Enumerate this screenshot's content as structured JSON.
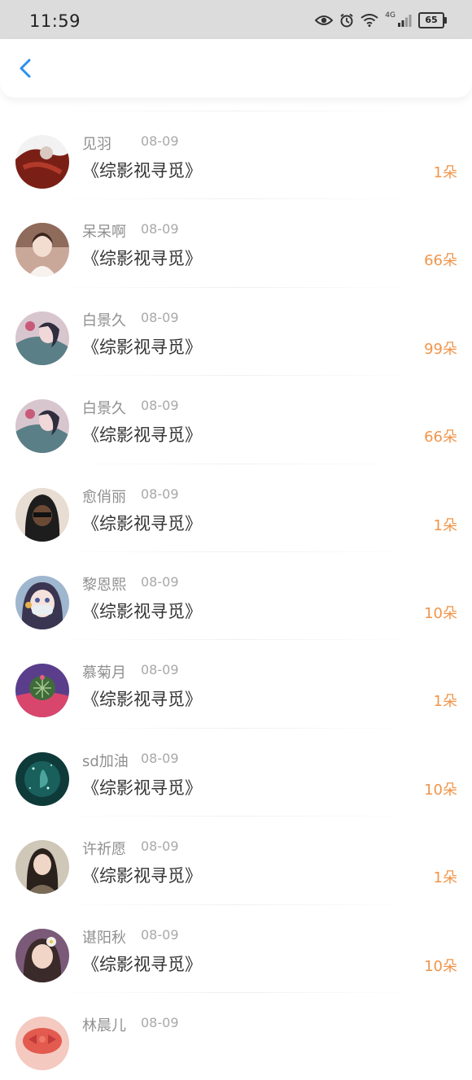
{
  "status_bar": {
    "time": "11:59",
    "battery": "65",
    "network": "4G"
  },
  "nav": {
    "back_icon": "chevron-left-icon",
    "accent_color": "#2b8ff0"
  },
  "amount_color": "#f0954a",
  "gifts": [
    {
      "name": "见羽",
      "date": "08-09",
      "title": "《综影视寻觅》",
      "amount": "1朵"
    },
    {
      "name": "呆呆啊",
      "date": "08-09",
      "title": "《综影视寻觅》",
      "amount": "66朵"
    },
    {
      "name": "白景久",
      "date": "08-09",
      "title": "《综影视寻觅》",
      "amount": "99朵"
    },
    {
      "name": "白景久",
      "date": "08-09",
      "title": "《综影视寻觅》",
      "amount": "66朵"
    },
    {
      "name": "愈俏丽",
      "date": "08-09",
      "title": "《综影视寻觅》",
      "amount": "1朵"
    },
    {
      "name": "黎恩熙",
      "date": "08-09",
      "title": "《综影视寻觅》",
      "amount": "10朵"
    },
    {
      "name": "慕菊月",
      "date": "08-09",
      "title": "《综影视寻觅》",
      "amount": "1朵"
    },
    {
      "name": "sd加油",
      "date": "08-09",
      "title": "《综影视寻觅》",
      "amount": "10朵"
    },
    {
      "name": "许祈愿",
      "date": "08-09",
      "title": "《综影视寻觅》",
      "amount": "1朵"
    },
    {
      "name": "谌阳秋",
      "date": "08-09",
      "title": "《综影视寻觅》",
      "amount": "10朵"
    },
    {
      "name": "林晨儿",
      "date": "08-09",
      "title": "",
      "amount": ""
    }
  ]
}
